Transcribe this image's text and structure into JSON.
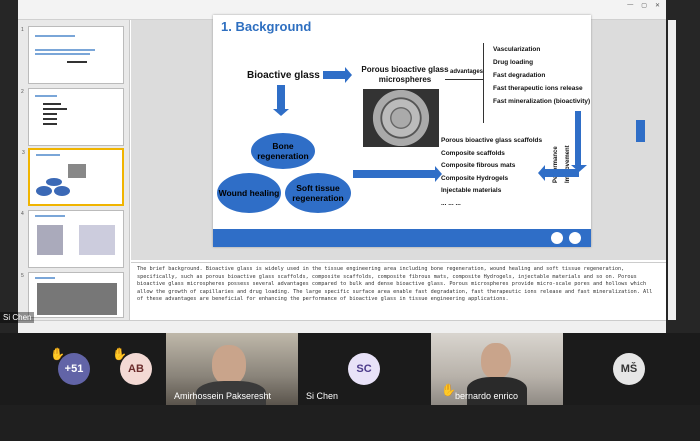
{
  "presenter": "Si Chen",
  "slide": {
    "title": "1. Background",
    "bioactive_glass": "Bioactive glass",
    "porous": "Porous bioactive glass microspheres",
    "advantages_label": "advantages",
    "advantages": [
      "Vascularization",
      "Drug loading",
      "Fast degradation",
      "Fast therapeutic ions release",
      "Fast mineralization (bioactivity)"
    ],
    "ellipses": [
      "Bone regeneration",
      "Wound healing",
      "Soft tissue regeneration"
    ],
    "materials": [
      "Porous bioactive glass scaffolds",
      "Composite scaffolds",
      "Composite fibrous mats",
      "Composite Hydrogels",
      "Injectable materials",
      "... ... ..."
    ],
    "vertical_1": "Performance",
    "vertical_2": "Improvement"
  },
  "notes": "The brief background. Bioactive glass is widely used in the tissue engineering area including bone regeneration, wound healing and soft tissue regeneration, specifically, such as porous bioactive glass scaffolds, composite scaffolds, composite fibrous mats, composite Hydrogels, injectable materials and so on. Porous bioactive glass microspheres possess several advantages compared to bulk and dense bioactive glass. Porous microspheres provide micro-scale pores and hollows which allow the growth of capillaries and drug loading. The large specific surface area enable fast degradation, fast therapeutic ions release and fast mineralization. All of these advantages are beneficial for enhancing the performance of bioactive glass in tissue engineering applications.",
  "participants": {
    "overflow_count": "+51",
    "ab": "AB",
    "amir": "Amirhossein Pakseresht",
    "sc_initials": "SC",
    "sc_name": "Si Chen",
    "bernardo": "bernardo enrico",
    "ms": "MŠ"
  },
  "colors": {
    "accent": "#2f6ec7",
    "hand": "#f4c52c"
  }
}
